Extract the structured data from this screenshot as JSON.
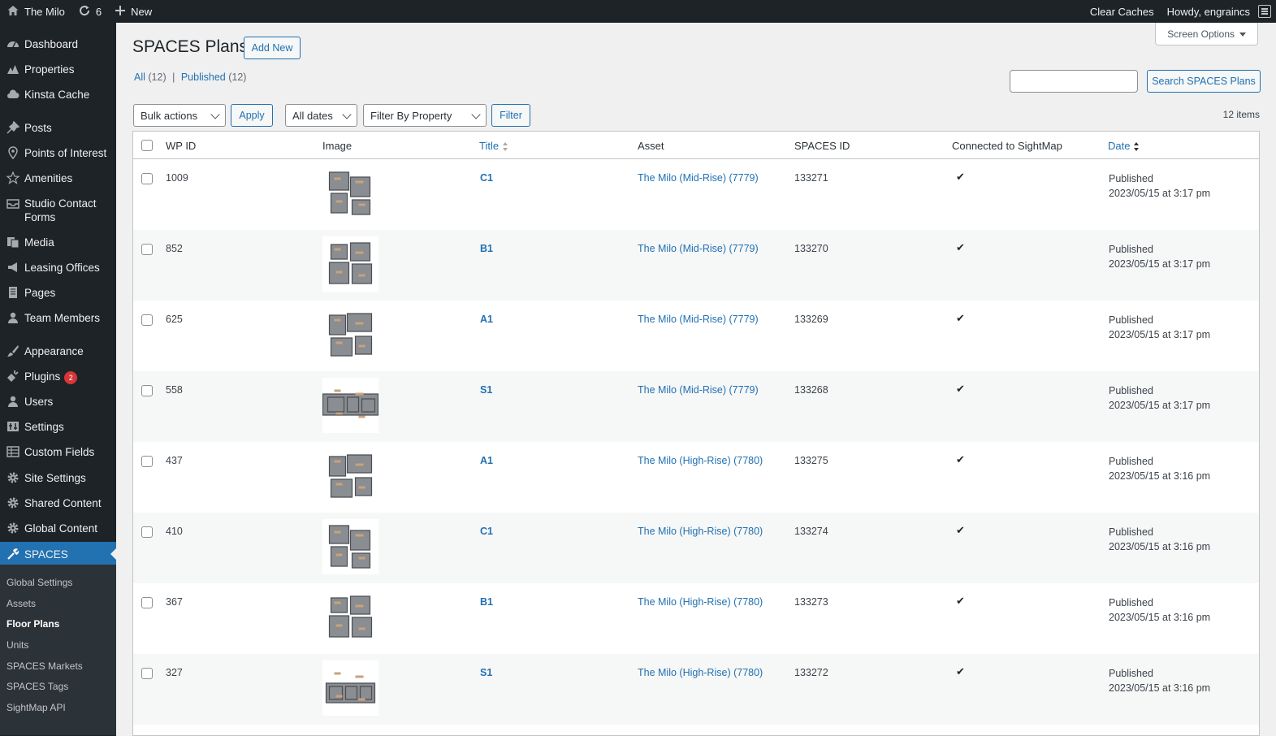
{
  "adminbar": {
    "site_name": "The Milo",
    "updates_count": "6",
    "new_label": "New",
    "clear_caches": "Clear Caches",
    "howdy": "Howdy, engraincs"
  },
  "sidebar": {
    "items": [
      {
        "label": "Dashboard",
        "icon": "dashboard-icon"
      },
      {
        "label": "Properties",
        "icon": "properties-icon"
      },
      {
        "label": "Kinsta Cache",
        "icon": "cloud-icon"
      },
      {
        "label": "Posts",
        "icon": "pin-icon"
      },
      {
        "label": "Points of Interest",
        "icon": "location-icon"
      },
      {
        "label": "Amenities",
        "icon": "star-icon"
      },
      {
        "label": "Studio Contact Forms",
        "icon": "inbox-icon"
      },
      {
        "label": "Media",
        "icon": "media-icon"
      },
      {
        "label": "Leasing Offices",
        "icon": "megaphone-icon"
      },
      {
        "label": "Pages",
        "icon": "pages-icon"
      },
      {
        "label": "Team Members",
        "icon": "person-icon"
      },
      {
        "label": "Appearance",
        "icon": "brush-icon"
      },
      {
        "label": "Plugins",
        "icon": "plugin-icon",
        "badge": "2"
      },
      {
        "label": "Users",
        "icon": "users-icon"
      },
      {
        "label": "Settings",
        "icon": "settings-icon"
      },
      {
        "label": "Custom Fields",
        "icon": "grid-icon"
      },
      {
        "label": "Site Settings",
        "icon": "gear-icon"
      },
      {
        "label": "Shared Content",
        "icon": "gear-icon"
      },
      {
        "label": "Global Content",
        "icon": "gear-icon"
      },
      {
        "label": "SPACES",
        "icon": "tool-icon"
      }
    ],
    "submenu": [
      {
        "label": "Global Settings"
      },
      {
        "label": "Assets"
      },
      {
        "label": "Floor Plans"
      },
      {
        "label": "Units"
      },
      {
        "label": "SPACES Markets"
      },
      {
        "label": "SPACES Tags"
      },
      {
        "label": "SightMap API"
      }
    ]
  },
  "screen_options": "Screen Options",
  "page": {
    "title": "SPACES Plans",
    "add_new": "Add New",
    "filter_all": "All",
    "filter_all_count": "(12)",
    "filter_sep": "|",
    "filter_published": "Published",
    "filter_published_count": "(12)",
    "search_button": "Search SPACES Plans",
    "bulk_actions": "Bulk actions",
    "apply": "Apply",
    "all_dates": "All dates",
    "filter_by_property": "Filter By Property",
    "filter": "Filter",
    "items_count": "12 items"
  },
  "table": {
    "headers": {
      "wp_id": "WP ID",
      "image": "Image",
      "title": "Title",
      "asset": "Asset",
      "spaces_id": "SPACES ID",
      "connected": "Connected to SightMap",
      "date": "Date"
    },
    "rows": [
      {
        "wp_id": "1009",
        "title": "C1",
        "asset": "The Milo (Mid-Rise) (7779)",
        "spaces_id": "133271",
        "connected": "✔",
        "status": "Published",
        "date": "2023/05/15 at 3:17 pm"
      },
      {
        "wp_id": "852",
        "title": "B1",
        "asset": "The Milo (Mid-Rise) (7779)",
        "spaces_id": "133270",
        "connected": "✔",
        "status": "Published",
        "date": "2023/05/15 at 3:17 pm"
      },
      {
        "wp_id": "625",
        "title": "A1",
        "asset": "The Milo (Mid-Rise) (7779)",
        "spaces_id": "133269",
        "connected": "✔",
        "status": "Published",
        "date": "2023/05/15 at 3:17 pm"
      },
      {
        "wp_id": "558",
        "title": "S1",
        "asset": "The Milo (Mid-Rise) (7779)",
        "spaces_id": "133268",
        "connected": "✔",
        "status": "Published",
        "date": "2023/05/15 at 3:17 pm"
      },
      {
        "wp_id": "437",
        "title": "A1",
        "asset": "The Milo (High-Rise) (7780)",
        "spaces_id": "133275",
        "connected": "✔",
        "status": "Published",
        "date": "2023/05/15 at 3:16 pm"
      },
      {
        "wp_id": "410",
        "title": "C1",
        "asset": "The Milo (High-Rise) (7780)",
        "spaces_id": "133274",
        "connected": "✔",
        "status": "Published",
        "date": "2023/05/15 at 3:16 pm"
      },
      {
        "wp_id": "367",
        "title": "B1",
        "asset": "The Milo (High-Rise) (7780)",
        "spaces_id": "133273",
        "connected": "✔",
        "status": "Published",
        "date": "2023/05/15 at 3:16 pm"
      },
      {
        "wp_id": "327",
        "title": "S1",
        "asset": "The Milo (High-Rise) (7780)",
        "spaces_id": "133272",
        "connected": "✔",
        "status": "Published",
        "date": "2023/05/15 at 3:16 pm"
      }
    ]
  },
  "colors": {
    "admin_dark": "#1d2327",
    "accent_blue": "#2271b1",
    "badge_red": "#d63638",
    "background": "#f0f0f1"
  }
}
